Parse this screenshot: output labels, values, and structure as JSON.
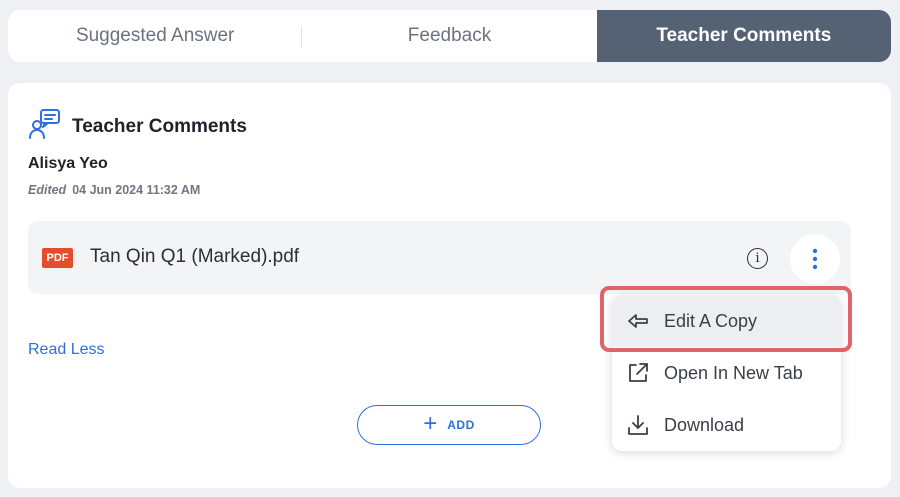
{
  "tabs": [
    {
      "label": "Suggested Answer"
    },
    {
      "label": "Feedback"
    },
    {
      "label": "Teacher Comments"
    }
  ],
  "active_tab": "Teacher Comments",
  "section": {
    "title": "Teacher Comments",
    "icon": "teacher-comment-icon"
  },
  "comment": {
    "author": "Alisya Yeo",
    "edited_label": "Edited",
    "edited_time": "04 Jun 2024 11:32 AM"
  },
  "attachment": {
    "type_badge": "PDF",
    "file_name": "Tan Qin Q1 (Marked).pdf",
    "info_icon": "info-icon",
    "more_icon": "more-vertical-icon"
  },
  "read_less": "Read Less",
  "add_button": {
    "label": "ADD",
    "icon": "plus-icon"
  },
  "menu": {
    "items": [
      {
        "label": "Edit A Copy",
        "icon": "reply-icon"
      },
      {
        "label": "Open In New Tab",
        "icon": "external-link-icon"
      },
      {
        "label": "Download",
        "icon": "download-icon"
      }
    ]
  },
  "colors": {
    "active_tab_bg": "#556273",
    "link_blue": "#2f6fe0",
    "pdf_red": "#e44c2b",
    "highlight_red": "#e0636a"
  }
}
